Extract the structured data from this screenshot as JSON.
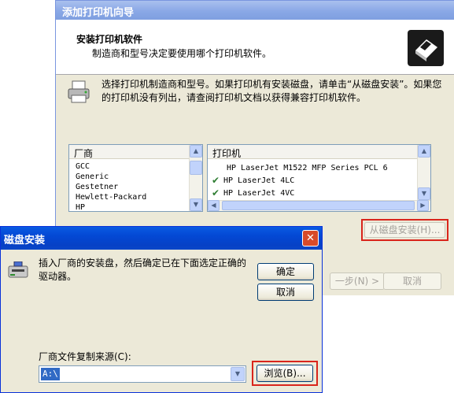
{
  "wizard": {
    "title": "添加打印机向导",
    "header_title": "安装打印机软件",
    "header_subtitle": "制造商和型号决定要使用哪个打印机软件。",
    "instruction": "选择打印机制造商和型号。如果打印机有安装磁盘，请单击“从磁盘安装”。如果您的打印机没有列出，请查阅打印机文档以获得兼容打印机软件。",
    "manufacturer_header": "厂商",
    "manufacturers": [
      "GCC",
      "Generic",
      "Gestetner",
      "Hewlett-Packard",
      "HP"
    ],
    "printer_header": "打印机",
    "printers": [
      {
        "name": "HP LaserJet M1522 MFP Series PCL 6",
        "certified": false
      },
      {
        "name": "HP LaserJet 4LC",
        "certified": true
      },
      {
        "name": "HP LaserJet 4VC",
        "certified": true
      }
    ],
    "have_disk_label": "从磁盘安装(H)...",
    "next_label": "一步(N) >",
    "cancel_label": "取消"
  },
  "dialog": {
    "title": "磁盘安装",
    "close_glyph": "✕",
    "message": "插入厂商的安装盘，然后确定已在下面选定正确的驱动器。",
    "ok_label": "确定",
    "cancel_label": "取消",
    "source_label": "厂商文件复制来源(C):",
    "source_value": "A:\\",
    "browse_label": "浏览(B)..."
  },
  "colors": {
    "highlight_red": "#d9251c",
    "xp_title_blue": "#0348d4",
    "dialog_face": "#ece9d8"
  },
  "icons": [
    "printer-icon",
    "disk-drive-icon",
    "wizard-printer-icon",
    "check-icon",
    "close-icon"
  ]
}
